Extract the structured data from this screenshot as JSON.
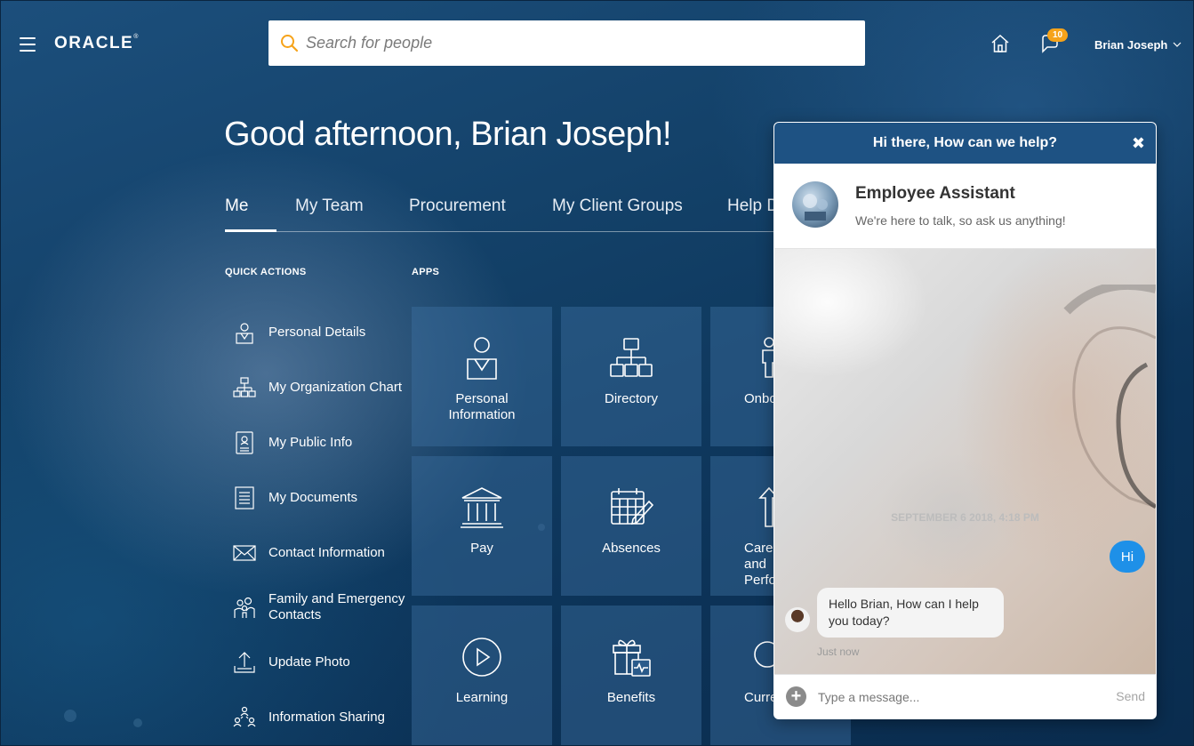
{
  "header": {
    "logo": "ORACLE",
    "search_placeholder": "Search for people",
    "notification_count": "10",
    "user_name": "Brian Joseph"
  },
  "greeting": "Good afternoon, Brian Joseph!",
  "tabs": [
    {
      "label": "Me",
      "active": true
    },
    {
      "label": "My Team"
    },
    {
      "label": "Procurement"
    },
    {
      "label": "My Client Groups"
    },
    {
      "label": "Help Desk"
    }
  ],
  "quick_actions": {
    "title": "QUICK ACTIONS",
    "items": [
      {
        "label": "Personal Details",
        "icon": "person-badge-icon"
      },
      {
        "label": "My Organization Chart",
        "icon": "org-chart-icon"
      },
      {
        "label": "My Public Info",
        "icon": "id-card-icon"
      },
      {
        "label": "My Documents",
        "icon": "document-icon"
      },
      {
        "label": "Contact Information",
        "icon": "envelope-icon"
      },
      {
        "label": "Family and Emergency Contacts",
        "icon": "family-icon"
      },
      {
        "label": "Update Photo",
        "icon": "upload-icon"
      },
      {
        "label": "Information Sharing",
        "icon": "sharing-icon"
      }
    ]
  },
  "apps": {
    "title": "APPS",
    "tiles": [
      {
        "label": "Personal Information",
        "icon": "person-icon"
      },
      {
        "label": "Directory",
        "icon": "directory-icon"
      },
      {
        "label": "Onboarding",
        "icon": "onboarding-icon"
      },
      {
        "label": "Pay",
        "icon": "bank-icon"
      },
      {
        "label": "Absences",
        "icon": "calendar-pen-icon"
      },
      {
        "label": "Career and Performance",
        "icon": "arrow-up-icon"
      },
      {
        "label": "Learning",
        "icon": "play-icon"
      },
      {
        "label": "Benefits",
        "icon": "gift-health-icon"
      },
      {
        "label": "Current Jobs",
        "icon": "search-jobs-icon"
      }
    ]
  },
  "chat": {
    "header": "Hi there, How can we help?",
    "assistant_name": "Employee Assistant",
    "assistant_sub": "We're here to talk, so ask us anything!",
    "date": "SEPTEMBER 6 2018, 4:18 PM",
    "user_message": "Hi",
    "bot_message": "Hello Brian, How can I help you today?",
    "bot_time": "Just now",
    "input_placeholder": "Type a message...",
    "send_label": "Send"
  },
  "colors": {
    "background": "#123f66",
    "chat_header": "#1e5283",
    "user_bubble": "#1e90e8",
    "badge": "#f6a31a"
  }
}
